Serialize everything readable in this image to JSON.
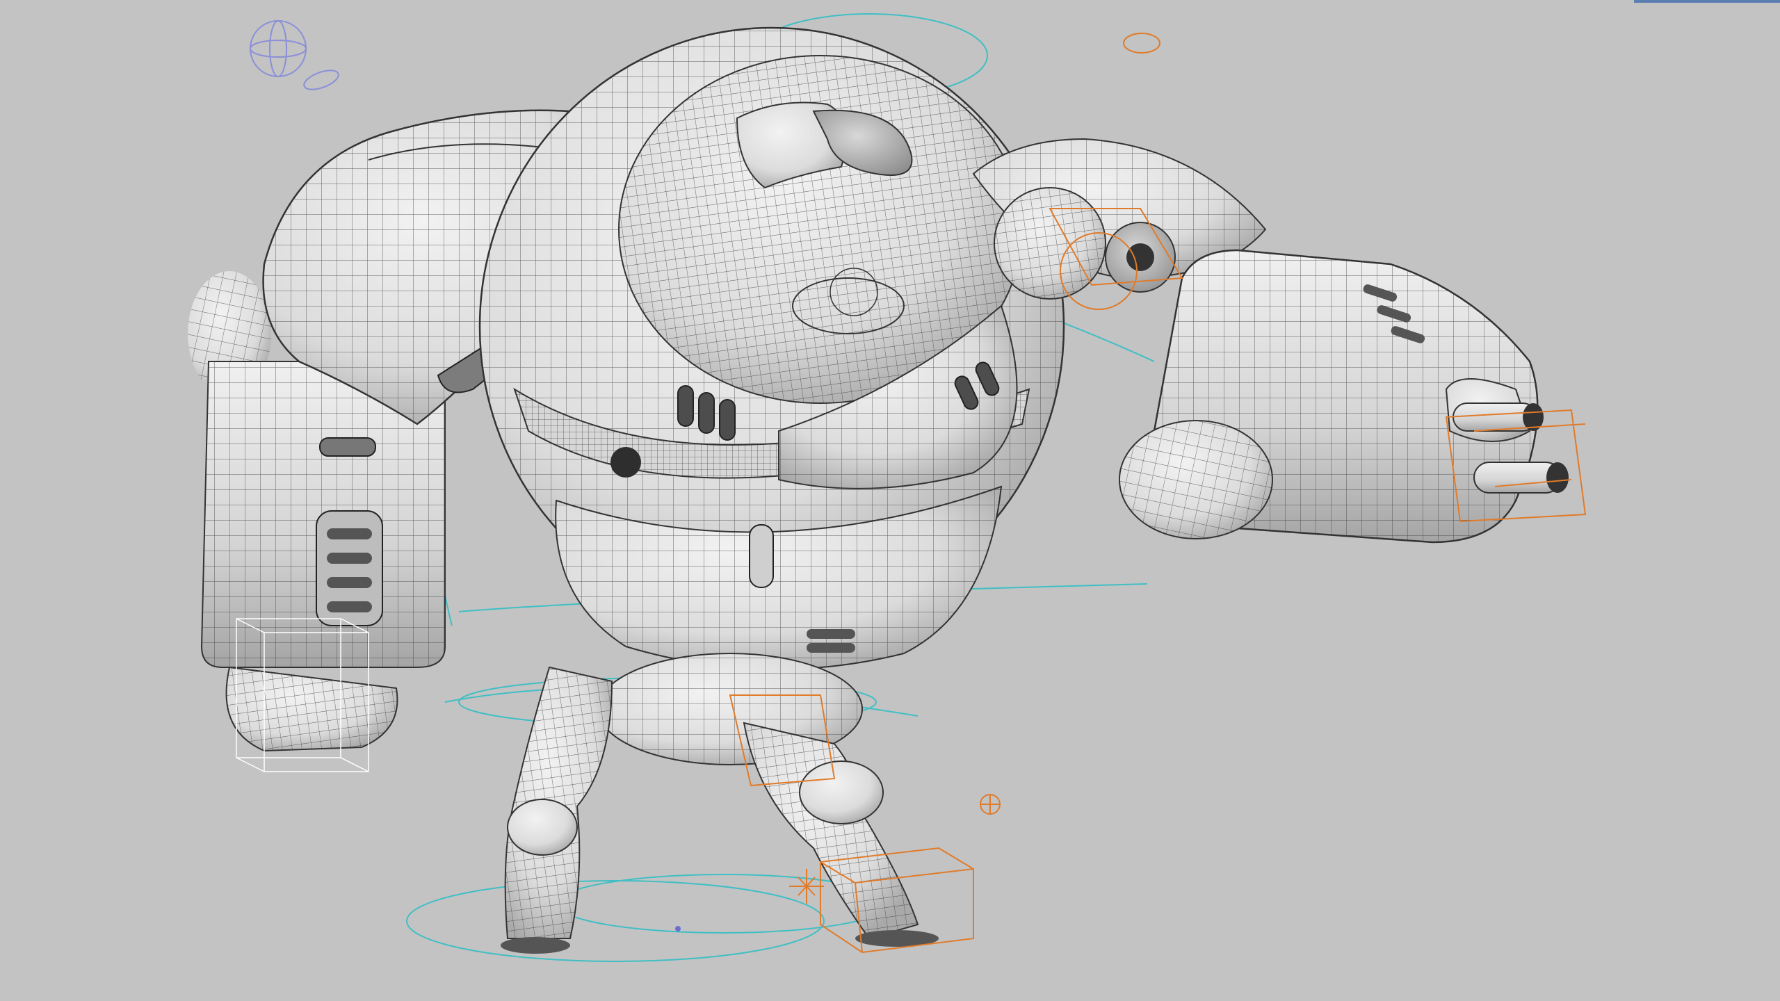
{
  "viewport": {
    "background": "#c3c3c3",
    "display_mode": "wireframe-on-shaded",
    "subject": "robot-character-rig"
  },
  "colors": {
    "mesh_fill": "#e9e9e9",
    "mesh_shadow": "#bdbdbd",
    "wire": "#3a3a3a",
    "nurbs_curve": "#3fbfc4",
    "selected_control": "#e07b2a",
    "locator": "#6b6fd0",
    "bounding_box": "#ffffff"
  },
  "icons": [
    "translate-locator-icon",
    "pivot-locator-icon",
    "joint-sphere-icon"
  ]
}
